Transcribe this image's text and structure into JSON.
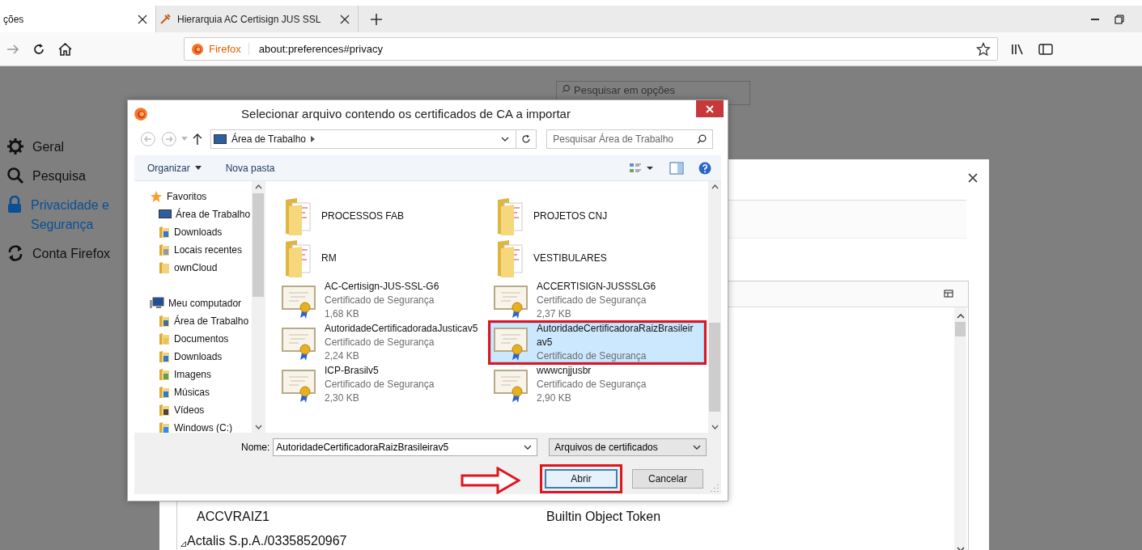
{
  "browser": {
    "tabs": [
      {
        "label": "ções",
        "selected": true
      },
      {
        "label": "Hierarquia AC Certisign JUS SSL",
        "selected": false
      }
    ],
    "url_badge": "Firefox",
    "url": "about:preferences#privacy"
  },
  "preferences": {
    "search_placeholder": "Pesquisar em opções",
    "sidebar": [
      {
        "label": "Geral",
        "kind": "gear",
        "selected": false
      },
      {
        "label": "Pesquisa",
        "kind": "search",
        "selected": false
      },
      {
        "label": "Privacidade e Segurança",
        "kind": "lock",
        "selected": true
      },
      {
        "label": "Conta Firefox",
        "kind": "sync",
        "selected": false
      }
    ]
  },
  "certificate_manager": {
    "rows": [
      {
        "kind": "cert",
        "name": "ACCVRAIZ1",
        "device": "Builtin Object Token"
      },
      {
        "kind": "group",
        "name": "Actalis S.p.A./03358520967"
      }
    ]
  },
  "file_dialog": {
    "title": "Selecionar arquivo contendo os certificados de CA a importar",
    "location": "Área de Trabalho",
    "search_placeholder": "Pesquisar Área de Trabalho",
    "toolbar": [
      {
        "label": "Organizar",
        "kind": "menu"
      },
      {
        "label": "Nova pasta",
        "kind": "plain"
      }
    ],
    "nav": [
      {
        "label": "Favoritos",
        "kind": "star",
        "children": [
          {
            "label": "Área de Trabalho",
            "kind": "desktop"
          },
          {
            "label": "Downloads",
            "kind": "downloads"
          },
          {
            "label": "Locais recentes",
            "kind": "recent"
          },
          {
            "label": "ownCloud",
            "kind": "folder"
          }
        ]
      },
      {
        "label": "Meu computador",
        "kind": "computer",
        "children": [
          {
            "label": "Área de Trabalho",
            "kind": "desktop"
          },
          {
            "label": "Documentos",
            "kind": "documents"
          },
          {
            "label": "Downloads",
            "kind": "downloads"
          },
          {
            "label": "Imagens",
            "kind": "images"
          },
          {
            "label": "Músicas",
            "kind": "music"
          },
          {
            "label": "Vídeos",
            "kind": "videos"
          },
          {
            "label": "Windows (C:)",
            "kind": "drive"
          }
        ]
      }
    ],
    "files": [
      {
        "kind": "folder",
        "name": "PROCESSOS FAB",
        "selected": false,
        "highlighted": false
      },
      {
        "kind": "folder",
        "name": "PROJETOS CNJ",
        "selected": false,
        "highlighted": false
      },
      {
        "kind": "folder",
        "name": "RM",
        "selected": false,
        "highlighted": false
      },
      {
        "kind": "folder",
        "name": "VESTIBULARES",
        "selected": false,
        "highlighted": false
      },
      {
        "kind": "cert",
        "name": "AC-Certisign-JUS-SSL-G6",
        "type": "Certificado de Segurança",
        "size": "1,68 KB",
        "selected": false,
        "highlighted": false
      },
      {
        "kind": "cert",
        "name": "ACCERTISIGN-JUSSSLG6",
        "type": "Certificado de Segurança",
        "size": "2,37 KB",
        "selected": false,
        "highlighted": false
      },
      {
        "kind": "cert",
        "name": "AutoridadeCertificadoradaJusticav5",
        "type": "Certificado de Segurança",
        "size": "2,24 KB",
        "selected": false,
        "highlighted": false
      },
      {
        "kind": "cert",
        "name": "AutoridadeCertificadoraRaizBrasileirav5",
        "type": "Certificado de Segurança",
        "selected": true,
        "highlighted": true
      },
      {
        "kind": "cert",
        "name": "ICP-Brasilv5",
        "type": "Certificado de Segurança",
        "size": "2,30 KB",
        "selected": false,
        "highlighted": false
      },
      {
        "kind": "cert",
        "name": "wwwcnjjusbr",
        "type": "Certificado de Segurança",
        "size": "2,90 KB",
        "selected": false,
        "highlighted": false
      }
    ],
    "filename_label": "Nome:",
    "filename": "AutoridadeCertificadoraRaizBrasileirav5",
    "filetype": "Arquivos de certificados",
    "buttons": [
      {
        "label": "Abrir",
        "default": true,
        "highlighted": true
      },
      {
        "label": "Cancelar",
        "default": false,
        "highlighted": false
      }
    ]
  }
}
